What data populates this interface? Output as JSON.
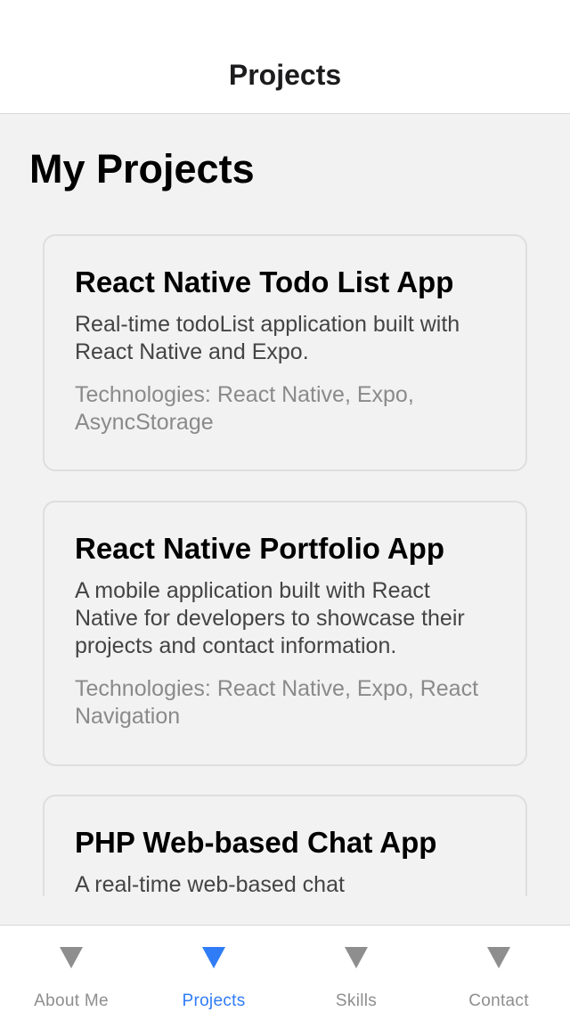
{
  "header": {
    "title": "Projects"
  },
  "main": {
    "heading": "My Projects",
    "projects": [
      {
        "title": "React Native Todo List App",
        "description": "Real-time todoList application built with React Native and Expo.",
        "technologies": "Technologies: React Native, Expo, AsyncStorage"
      },
      {
        "title": "React Native Portfolio App",
        "description": "A mobile application built with React Native for developers to showcase their projects and contact information.",
        "technologies": "Technologies: React Native, Expo, React Navigation"
      },
      {
        "title": "PHP Web-based Chat App",
        "description": "A real-time web-based chat"
      }
    ]
  },
  "tabbar": {
    "active_color": "#2f7cf6",
    "inactive_color": "#8e8e8e",
    "tabs": [
      {
        "label": "About Me",
        "icon": "triangle-down-icon",
        "active": false
      },
      {
        "label": "Projects",
        "icon": "triangle-down-icon",
        "active": true
      },
      {
        "label": "Skills",
        "icon": "triangle-down-icon",
        "active": false
      },
      {
        "label": "Contact",
        "icon": "triangle-down-icon",
        "active": false
      }
    ]
  }
}
